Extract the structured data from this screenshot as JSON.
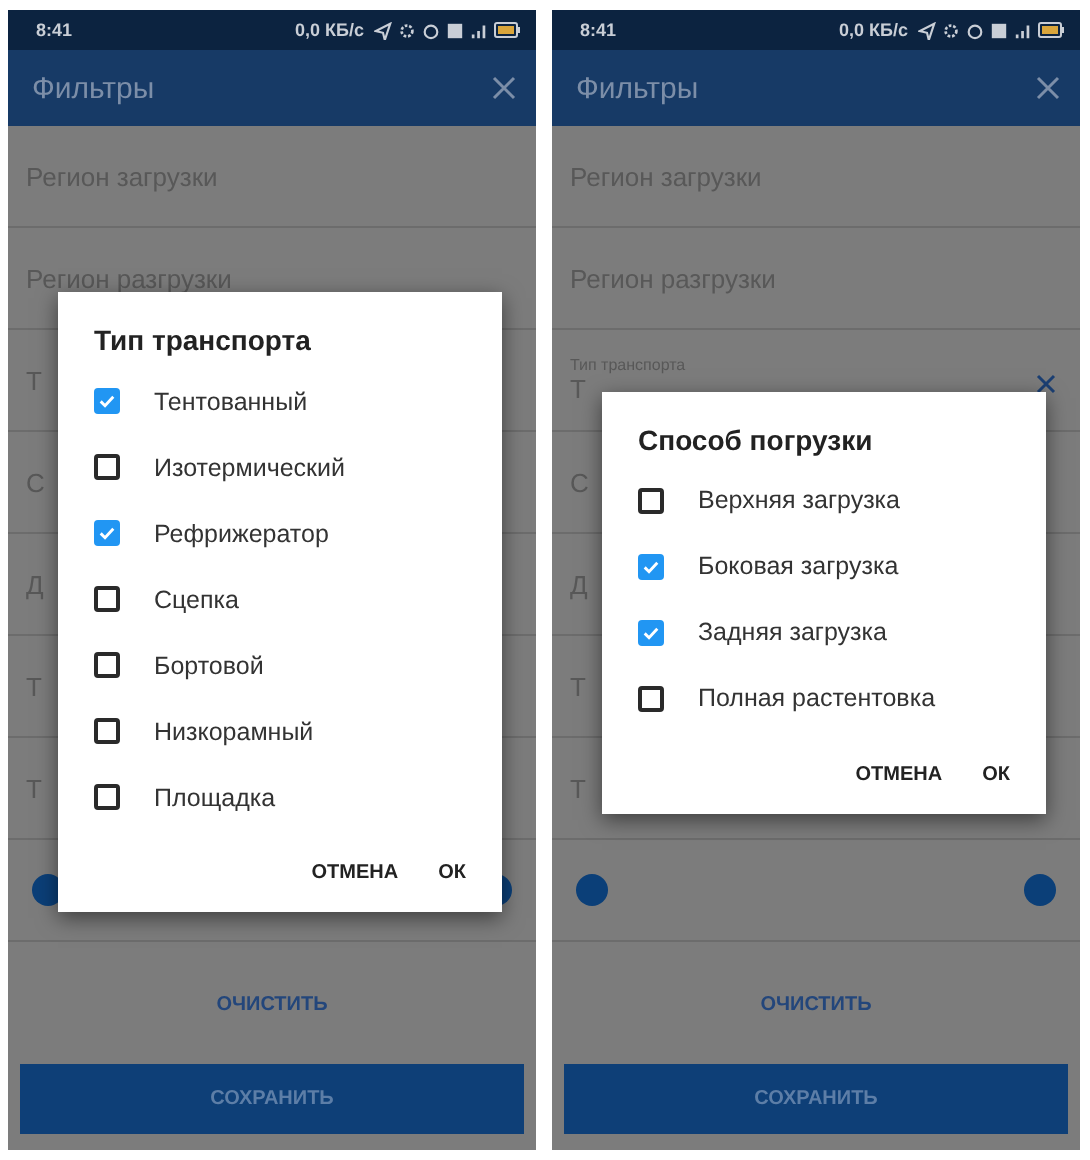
{
  "screens": [
    {
      "status_bar": {
        "time": "8:41",
        "speed": "0,0 КБ/с"
      },
      "app_bar": {
        "title": "Фильтры"
      },
      "fields": [
        {
          "kind": "plain",
          "text": "Регион загрузки"
        },
        {
          "kind": "plain",
          "text": "Регион разгрузки"
        },
        {
          "kind": "plain",
          "text": "Т"
        },
        {
          "kind": "plain",
          "text": "С"
        },
        {
          "kind": "plain",
          "text": "Д"
        },
        {
          "kind": "plain",
          "text": "Т"
        },
        {
          "kind": "plain",
          "text": "Т"
        }
      ],
      "dialog": {
        "title": "Тип транспорта",
        "options": [
          {
            "label": "Тентованный",
            "checked": true
          },
          {
            "label": "Изотермический",
            "checked": false
          },
          {
            "label": "Рефрижератор",
            "checked": true
          },
          {
            "label": "Сцепка",
            "checked": false
          },
          {
            "label": "Бортовой",
            "checked": false
          },
          {
            "label": "Низкорамный",
            "checked": false
          },
          {
            "label": "Площадка",
            "checked": false
          }
        ],
        "cancel": "ОТМЕНА",
        "ok": "ОК"
      },
      "clear_button": "ОЧИСТИТЬ",
      "save_button": "СОХРАНИТЬ"
    },
    {
      "status_bar": {
        "time": "8:41",
        "speed": "0,0 КБ/с"
      },
      "app_bar": {
        "title": "Фильтры"
      },
      "fields": [
        {
          "kind": "plain",
          "text": "Регион загрузки"
        },
        {
          "kind": "plain",
          "text": "Регион разгрузки"
        },
        {
          "kind": "labeled",
          "label": "Тип транспорта",
          "text": "Т"
        },
        {
          "kind": "plain",
          "text": "С"
        },
        {
          "kind": "plain",
          "text": "Д"
        },
        {
          "kind": "plain",
          "text": "Т"
        },
        {
          "kind": "plain",
          "text": "Т"
        }
      ],
      "dialog": {
        "title": "Способ погрузки",
        "options": [
          {
            "label": "Верхняя загрузка",
            "checked": false
          },
          {
            "label": "Боковая загрузка",
            "checked": true
          },
          {
            "label": "Задняя загрузка",
            "checked": true
          },
          {
            "label": "Полная растентовка",
            "checked": false
          }
        ],
        "cancel": "ОТМЕНА",
        "ok": "ОК"
      },
      "clear_button": "ОЧИСТИТЬ",
      "save_button": "СОХРАНИТЬ"
    }
  ]
}
